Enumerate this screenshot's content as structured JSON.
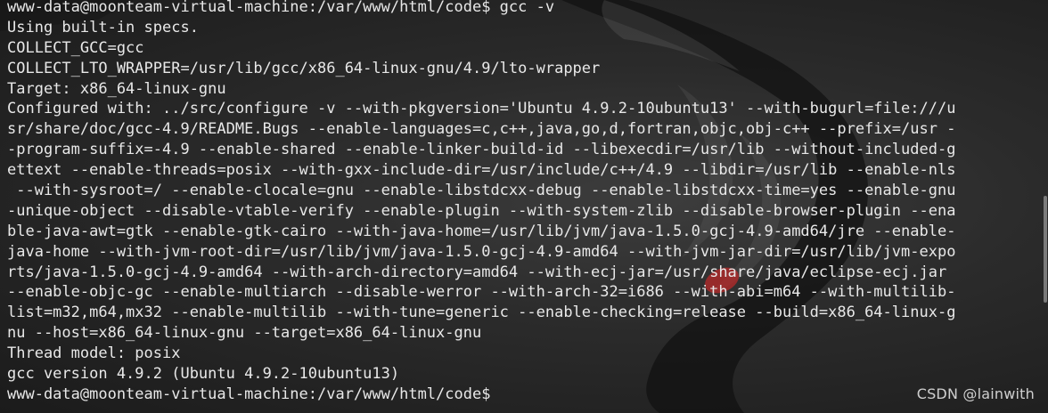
{
  "terminal": {
    "lines": [
      "www-data@moonteam-virtual-machine:/var/www/html/code$ gcc -v",
      "Using built-in specs.",
      "COLLECT_GCC=gcc",
      "COLLECT_LTO_WRAPPER=/usr/lib/gcc/x86_64-linux-gnu/4.9/lto-wrapper",
      "Target: x86_64-linux-gnu",
      "Configured with: ../src/configure -v --with-pkgversion='Ubuntu 4.9.2-10ubuntu13' --with-bugurl=file:///u",
      "sr/share/doc/gcc-4.9/README.Bugs --enable-languages=c,c++,java,go,d,fortran,objc,obj-c++ --prefix=/usr -",
      "-program-suffix=-4.9 --enable-shared --enable-linker-build-id --libexecdir=/usr/lib --without-included-g",
      "ettext --enable-threads=posix --with-gxx-include-dir=/usr/include/c++/4.9 --libdir=/usr/lib --enable-nls",
      " --with-sysroot=/ --enable-clocale=gnu --enable-libstdcxx-debug --enable-libstdcxx-time=yes --enable-gnu",
      "-unique-object --disable-vtable-verify --enable-plugin --with-system-zlib --disable-browser-plugin --ena",
      "ble-java-awt=gtk --enable-gtk-cairo --with-java-home=/usr/lib/jvm/java-1.5.0-gcj-4.9-amd64/jre --enable-",
      "java-home --with-jvm-root-dir=/usr/lib/jvm/java-1.5.0-gcj-4.9-amd64 --with-jvm-jar-dir=/usr/lib/jvm-expo",
      "rts/java-1.5.0-gcj-4.9-amd64 --with-arch-directory=amd64 --with-ecj-jar=/usr/share/java/eclipse-ecj.jar",
      "--enable-objc-gc --enable-multiarch --disable-werror --with-arch-32=i686 --with-abi=m64 --with-multilib-",
      "list=m32,m64,mx32 --enable-multilib --with-tune=generic --enable-checking=release --build=x86_64-linux-g",
      "nu --host=x86_64-linux-gnu --target=x86_64-linux-gnu",
      "Thread model: posix",
      "gcc version 4.9.2 (Ubuntu 4.9.2-10ubuntu13)"
    ],
    "final_prompt": "www-data@moonteam-virtual-machine:/var/www/html/code$"
  },
  "watermark": "CSDN @lainwith",
  "colors": {
    "background": "#1f1f1f",
    "text": "#e8e8e8",
    "wallpaper_accent": "#b52a2a"
  }
}
